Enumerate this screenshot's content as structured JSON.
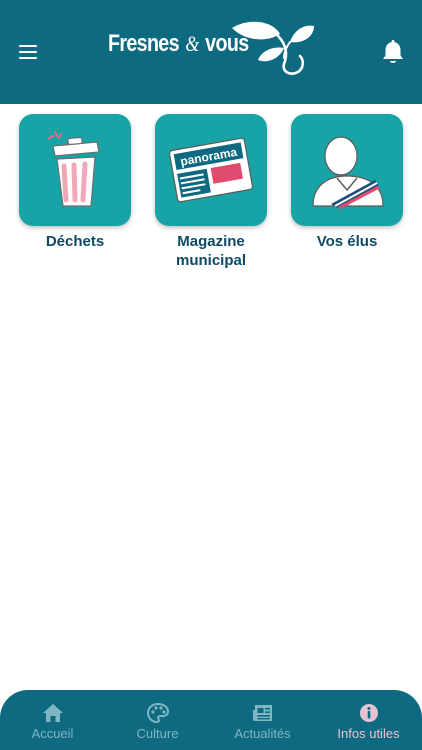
{
  "header": {
    "logo_part1": "Fresnes",
    "logo_amp": "&",
    "logo_part2": "vous",
    "menu_icon": "hamburger-menu-icon",
    "notifications_icon": "bell-icon"
  },
  "tiles": [
    {
      "label": "Déchets",
      "icon": "trash-bin-icon"
    },
    {
      "label": "Magazine municipal",
      "icon": "magazine-icon",
      "icon_text": "panorama"
    },
    {
      "label": "Vos élus",
      "icon": "elected-official-icon"
    }
  ],
  "bottom_nav": {
    "items": [
      {
        "label": "Accueil",
        "icon": "home-icon",
        "active": false
      },
      {
        "label": "Culture",
        "icon": "palette-icon",
        "active": false
      },
      {
        "label": "Actualités",
        "icon": "newspaper-icon",
        "active": false
      },
      {
        "label": "Infos utiles",
        "icon": "info-icon",
        "active": true
      }
    ]
  },
  "colors": {
    "header_bg": "#0e6a80",
    "tile_bg": "#18a3a6",
    "tile_label": "#0d4a63",
    "nav_inactive": "#7fb6c4",
    "nav_active": "#e7c2d3",
    "accent_pink": "#f2a7b9"
  }
}
